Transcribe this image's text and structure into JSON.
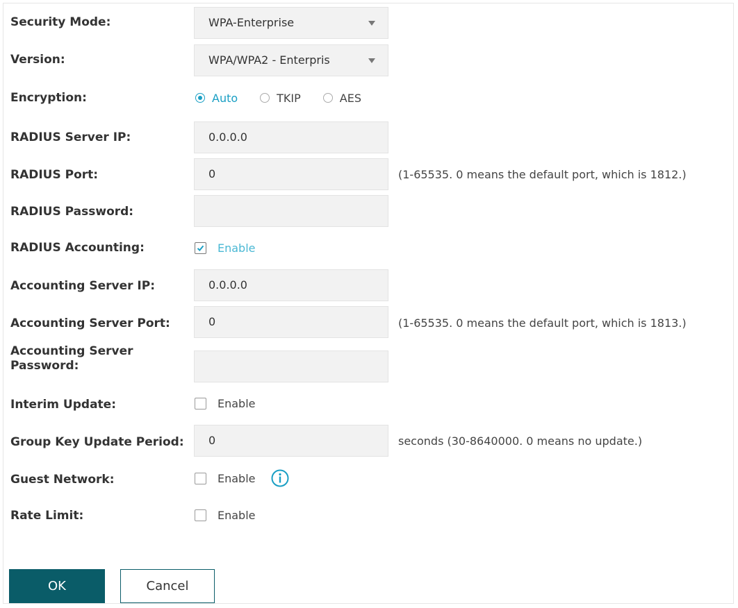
{
  "form": {
    "security_mode": {
      "label": "Security Mode:",
      "value": "WPA-Enterprise"
    },
    "version": {
      "label": "Version:",
      "value": "WPA/WPA2 - Enterpris"
    },
    "encryption": {
      "label": "Encryption:",
      "options": [
        "Auto",
        "TKIP",
        "AES"
      ],
      "selected": "Auto"
    },
    "radius_server_ip": {
      "label": "RADIUS Server IP:",
      "value": "0.0.0.0"
    },
    "radius_port": {
      "label": "RADIUS Port:",
      "value": "0",
      "hint": "(1-65535. 0 means the default port, which is 1812.)"
    },
    "radius_password": {
      "label": "RADIUS Password:",
      "value": ""
    },
    "radius_accounting": {
      "label": "RADIUS Accounting:",
      "checkbox_label": "Enable",
      "checked": true
    },
    "accounting_server_ip": {
      "label": "Accounting Server IP:",
      "value": "0.0.0.0"
    },
    "accounting_server_port": {
      "label": "Accounting Server Port:",
      "value": "0",
      "hint": "(1-65535. 0 means the default port, which is 1813.)"
    },
    "accounting_server_password": {
      "label_line1": "Accounting Server",
      "label_line2": "Password:",
      "value": ""
    },
    "interim_update": {
      "label": "Interim Update:",
      "checkbox_label": "Enable",
      "checked": false
    },
    "group_key_update_period": {
      "label": "Group Key Update Period:",
      "value": "0",
      "hint": "seconds (30-8640000. 0 means no update.)"
    },
    "guest_network": {
      "label": "Guest Network:",
      "checkbox_label": "Enable",
      "checked": false,
      "icon": "info-icon"
    },
    "rate_limit": {
      "label": "Rate Limit:",
      "checkbox_label": "Enable",
      "checked": false
    }
  },
  "buttons": {
    "ok": "OK",
    "cancel": "Cancel"
  },
  "colors": {
    "accent": "#1a9fc4",
    "button_primary": "#0a5c68",
    "field_bg": "#f2f2f2"
  }
}
